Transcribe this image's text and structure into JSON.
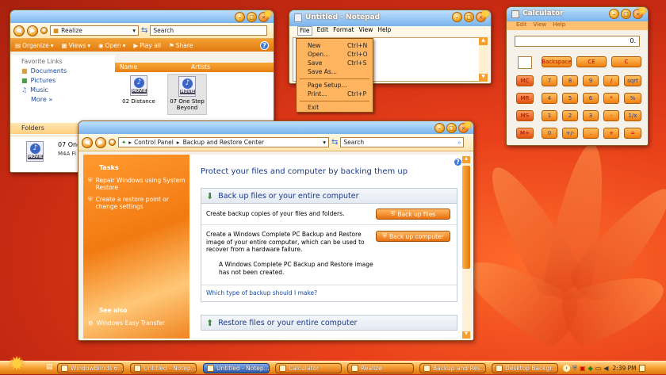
{
  "explorer": {
    "address": "Realize",
    "search_placeholder": "Search",
    "toolbar": {
      "organize": "Organize",
      "views": "Views",
      "open": "Open",
      "play_all": "Play all",
      "share": "Share"
    },
    "columns": {
      "name": "Name",
      "artists": "Artists"
    },
    "favorite_links_title": "Favorite Links",
    "favorites": [
      "Documents",
      "Pictures",
      "Music"
    ],
    "more": "More",
    "folders": "Folders",
    "files": [
      {
        "icon_label": "MOVIE",
        "name": "02 Distance"
      },
      {
        "icon_label": "MOVIE",
        "name": "07 One Step Beyond"
      }
    ],
    "preview_name": "07 One",
    "preview_type": "M4A Fi"
  },
  "notepad": {
    "title": "Untitled - Notepad",
    "menu": [
      "File",
      "Edit",
      "Format",
      "View",
      "Help"
    ],
    "file_menu": [
      {
        "label": "New",
        "shortcut": "Ctrl+N"
      },
      {
        "label": "Open...",
        "shortcut": "Ctrl+O"
      },
      {
        "label": "Save",
        "shortcut": "Ctrl+S"
      },
      {
        "label": "Save As...",
        "shortcut": ""
      },
      {
        "label": "Page Setup...",
        "shortcut": ""
      },
      {
        "label": "Print...",
        "shortcut": "Ctrl+P"
      },
      {
        "label": "Exit",
        "shortcut": ""
      }
    ]
  },
  "calculator": {
    "title": "Calculator",
    "menu": [
      "Edit",
      "View",
      "Help"
    ],
    "display": "0.",
    "top_row": [
      "Backspace",
      "CE",
      "C"
    ],
    "memory": [
      "MC",
      "MR",
      "MS",
      "M+"
    ],
    "rows": [
      [
        "7",
        "8",
        "9",
        "/",
        "sqrt"
      ],
      [
        "4",
        "5",
        "6",
        "*",
        "%"
      ],
      [
        "1",
        "2",
        "3",
        "-",
        "1/x"
      ],
      [
        "0",
        "+/-",
        ".",
        "+",
        "="
      ]
    ]
  },
  "backup": {
    "breadcrumb": [
      "Control Panel",
      "Backup and Restore Center"
    ],
    "search_placeholder": "Search",
    "tasks_title": "Tasks",
    "tasks": [
      "Repair Windows using System Restore",
      "Create a restore point or change settings"
    ],
    "see_also_title": "See also",
    "see_also": [
      "Windows Easy Transfer"
    ],
    "heading": "Protect your files and computer by backing them up",
    "section_backup_title": "Back up files or your entire computer",
    "backup_files_text": "Create backup copies of your files and folders.",
    "backup_files_button": "Back up files",
    "complete_text": "Create a Windows Complete PC Backup and Restore image of your entire computer, which can be used to recover from a hardware failure.",
    "backup_computer_button": "Back up computer",
    "image_status": "A Windows Complete PC Backup and Restore image has not been created.",
    "which_link": "Which type of backup should I make?",
    "section_restore_title": "Restore files or your entire computer"
  },
  "taskbar": {
    "buttons": [
      "WindowBlinds 6...",
      "Untitled - Notep...",
      "Untitled - Notep...",
      "Calculator",
      "Realize",
      "Backup and Res...",
      "Desktop Backgr..."
    ],
    "clock": "2:39 PM"
  }
}
